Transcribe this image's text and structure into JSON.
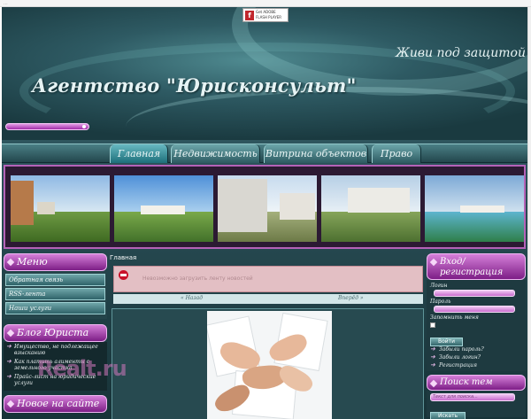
{
  "browser": {
    "topline": "..."
  },
  "header": {
    "flash_badge": {
      "line1": "Get ADOBE",
      "line2": "FLASH PLAYER"
    },
    "slogan": "Живи под защитой",
    "site_title": "Агентство \"Юрисконсульт\""
  },
  "nav": {
    "tabs": [
      {
        "label": "Главная",
        "active": true
      },
      {
        "label": "Недвижимость",
        "active": false
      },
      {
        "label": "Витрина объектов",
        "active": false
      },
      {
        "label": "Право",
        "active": false
      }
    ]
  },
  "left": {
    "menu_title": "Меню",
    "menu_items": [
      "Обратная связь",
      "RSS-лента",
      "Наши услуги"
    ],
    "blog_title": "Блог Юриста",
    "blog_items": [
      "Имущество, не подлежащее взысканию",
      "Как платить алименты с земельного участка",
      "Прайс-лист на юридические услуги"
    ],
    "news_title": "Новое на сайте"
  },
  "main": {
    "breadcrumb": "Главная",
    "alert_message": "Невозможно загрузить ленту новостей",
    "pager_prev": "« Назад",
    "pager_next": "Вперёд »"
  },
  "right": {
    "login_title": "Вход/ регистрация",
    "login_label": "Логин",
    "password_label": "Пароль",
    "remember_label": "Запомнить меня",
    "login_button": "Войти",
    "links": [
      "Забыли пароль?",
      "Забыли логин?",
      "Регистрация"
    ],
    "search_title": "Поиск тем",
    "search_placeholder": "Текст для поиска...",
    "search_button": "Искать"
  },
  "watermark": "Realt.ru"
}
